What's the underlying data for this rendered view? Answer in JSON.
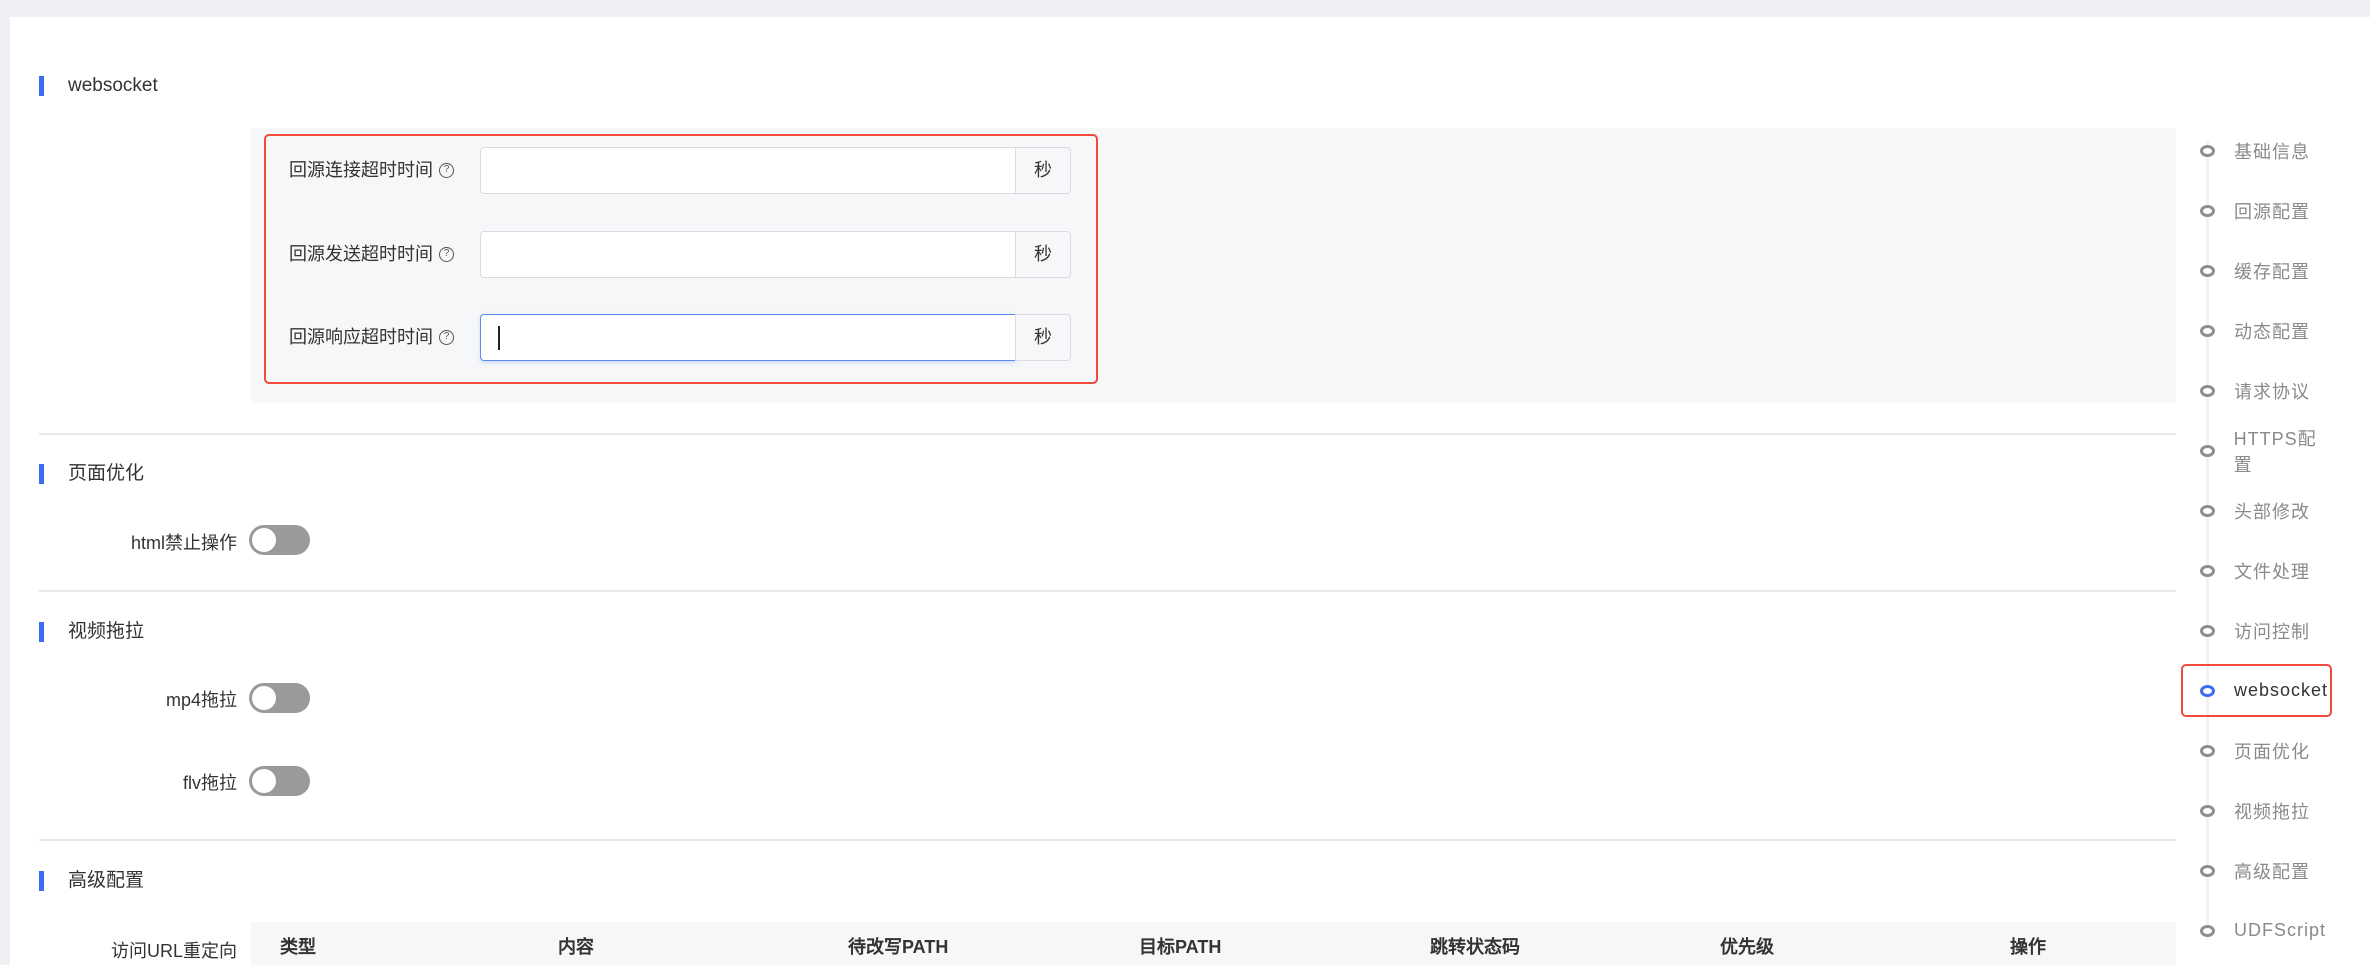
{
  "sections": {
    "websocket": {
      "title": "websocket",
      "fields": [
        {
          "label": "回源连接超时时间",
          "value": "",
          "suffix": "秒"
        },
        {
          "label": "回源发送超时时间",
          "value": "",
          "suffix": "秒"
        },
        {
          "label": "回源响应超时时间",
          "value": "",
          "suffix": "秒"
        }
      ],
      "help_glyph": "?"
    },
    "page_opt": {
      "title": "页面优化",
      "toggles": [
        {
          "label": "html禁止操作",
          "on": false
        }
      ]
    },
    "video": {
      "title": "视频拖拉",
      "toggles": [
        {
          "label": "mp4拖拉",
          "on": false
        },
        {
          "label": "flv拖拉",
          "on": false
        }
      ]
    },
    "advanced": {
      "title": "高级配置",
      "redirect_label": "访问URL重定向",
      "columns": [
        "类型",
        "内容",
        "待改写PATH",
        "目标PATH",
        "跳转状态码",
        "优先级",
        "操作"
      ]
    }
  },
  "nav": {
    "items": [
      "基础信息",
      "回源配置",
      "缓存配置",
      "动态配置",
      "请求协议",
      "HTTPS配置",
      "头部修改",
      "文件处理",
      "访问控制",
      "websocket",
      "页面优化",
      "视频拖拉",
      "高级配置",
      "UDFScript"
    ],
    "active": "websocket"
  },
  "colors": {
    "accent": "#3d6ef0",
    "highlight": "#f24a3d",
    "toggle_off": "#9a9a9a"
  }
}
